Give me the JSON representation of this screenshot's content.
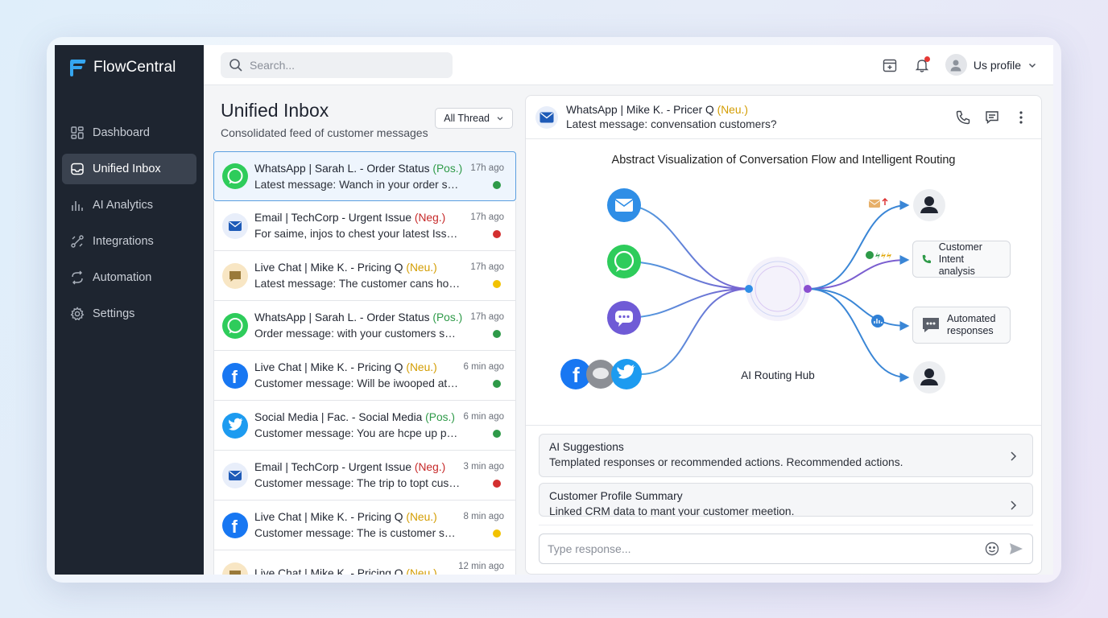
{
  "app": {
    "name": "FlowCentral"
  },
  "sidebar": {
    "items": [
      {
        "label": "Dashboard",
        "icon": "dashboard-icon"
      },
      {
        "label": "Unified Inbox",
        "icon": "inbox-icon",
        "active": true
      },
      {
        "label": "AI Analytics",
        "icon": "analytics-icon"
      },
      {
        "label": "Integrations",
        "icon": "integrations-icon"
      },
      {
        "label": "Automation",
        "icon": "automation-icon"
      },
      {
        "label": "Settings",
        "icon": "gear-icon"
      }
    ]
  },
  "topbar": {
    "search_placeholder": "Search...",
    "profile_label": "Us profile"
  },
  "inbox": {
    "title": "Unified Inbox",
    "subtitle": "Consolidated feed of customer messages",
    "filter_label": "All Thread",
    "messages": [
      {
        "channel": "whatsapp",
        "title": "WhatsApp | Sarah L. - Order Status ",
        "sentiment": "(Pos.)",
        "preview": "Latest message: Wanch in your order status updates",
        "time": "17h ago",
        "status_color": "#2e9a48",
        "selected": true
      },
      {
        "channel": "email",
        "title": "Email | TechCorp - Urgent Issue ",
        "sentiment": "(Neg.)",
        "preview": "For saime, injos to chest your latest Issue...",
        "time": "17h ago",
        "status_color": "#d32f2f"
      },
      {
        "channel": "chat",
        "title": "Live Chat | Mike K. - Pricing Q ",
        "sentiment": "(Neu.)",
        "preview": "Latest message: The customer cans how much it costs",
        "time": "17h ago",
        "status_color": "#f2c200"
      },
      {
        "channel": "whatsapp",
        "title": "WhatsApp | Sarah L. - Order Status ",
        "sentiment": "(Pos.)",
        "preview": "Order message: with your customers snts...",
        "time": "17h ago",
        "status_color": "#2e9a48"
      },
      {
        "channel": "facebook",
        "title": "Live Chat | Mike K. - Pricing Q ",
        "sentiment": "(Neu.)",
        "preview": "Customer message: Will be iwooped at a glance",
        "time": "6 min ago",
        "status_color": "#2e9a48"
      },
      {
        "channel": "twitter",
        "title": "Social Media | Fac.  - Social Media ",
        "sentiment": "(Pos.)",
        "preview": "Customer message: You are hcpe up pricing now",
        "time": "6 min ago",
        "status_color": "#2e9a48"
      },
      {
        "channel": "email",
        "title": "Email | TechCorp - Urgent Issue ",
        "sentiment": "(Neg.)",
        "preview": "Customer message: The trip to topt customer care",
        "time": "3 min ago",
        "status_color": "#d32f2f"
      },
      {
        "channel": "facebook",
        "title": "Live Chat | Mike K.  - Pricing Q ",
        "sentiment": "(Neu.)",
        "preview": "Customer message: The is customer spread out",
        "time": "8 min ago",
        "status_color": "#f2c200"
      },
      {
        "channel": "chat",
        "title": "Live Chat | Mike K.  - Pricing Q ",
        "sentiment": "(Neu.)",
        "preview": "",
        "time": "12 min ago",
        "status_color": "#f2c200"
      }
    ]
  },
  "detail": {
    "title": "WhatsApp | Mike K. - Pricer Q ",
    "sentiment": "(Neu.)",
    "subtitle": "Latest message: convensation customers?",
    "viz_title": "Abstract Visualization of Conversation Flow and Intelligent Routing",
    "hub_label": "AI Routing Hub",
    "card_intent_line1": "Customer",
    "card_intent_line2": "Intent analysis",
    "card_auto_line1": "Automated",
    "card_auto_line2": "responses",
    "ai_title": "AI Suggestions",
    "ai_desc": "Templated responses or recommended actions. Recommended actions.",
    "profile_title": "Customer Profile Summary",
    "profile_desc": "Linked CRM data to mant your customer meetion.",
    "reply_placeholder": "Type response..."
  },
  "colors": {
    "sidebar_bg": "#1e2530",
    "accent_blue": "#2f80d6",
    "positive": "#2e9a48",
    "negative": "#c62828",
    "neutral": "#d39c00"
  }
}
